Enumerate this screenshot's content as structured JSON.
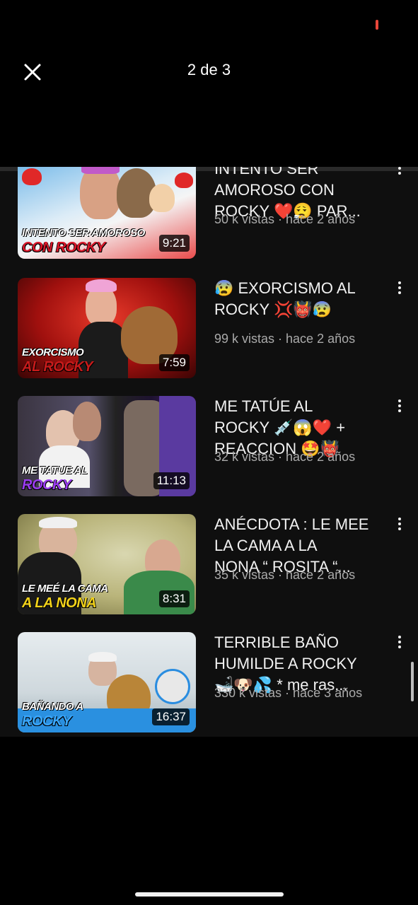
{
  "header": {
    "title": "2 de 3"
  },
  "videos": [
    {
      "title": "INTENTO SER\nAMOROSO CON\nROCKY ❤️😮‍💨 PAR...",
      "meta": "50 k vistas · hace 2 años",
      "duration": "9:21",
      "caption_line1": "INTENTO SER AMOROSO",
      "caption_line2": "CON ROCKY",
      "caption2_color": "#d8182a"
    },
    {
      "title": "😰 EXORCISMO AL\nROCKY 💢👹😰",
      "meta": "99 k vistas · hace 2 años",
      "duration": "7:59",
      "caption_line1": "EXORCISMO",
      "caption_line2": "AL ROCKY",
      "caption2_color": "#c81b1b"
    },
    {
      "title": "ME TATÚE AL\nROCKY 💉😱❤️ +\nREACCION 🤩👹",
      "meta": "32 k vistas · hace 2 años",
      "duration": "11:13",
      "caption_line1": "ME TATUE AL",
      "caption_line2": "ROCKY",
      "caption2_color": "#9a3cf0"
    },
    {
      "title": "ANÉCDOTA : LE MEE\nLA CAMA A LA\nNONA “ ROSITA “...",
      "meta": "35 k vistas · hace 2 años",
      "duration": "8:31",
      "caption_line1": "LE MEÉ LA CAMA",
      "caption_line2": "A LA NONA",
      "caption2_color": "#f2d21a"
    },
    {
      "title": "TERRIBLE BAÑO\nHUMILDE A ROCKY\n🛁🐶💦 * me ras...",
      "meta": "330 k vistas · hace 3 años",
      "duration": "16:37",
      "caption_line1": "BAÑANDO A",
      "caption_line2": "ROCKY",
      "caption2_color": "#3aa8ff"
    }
  ]
}
